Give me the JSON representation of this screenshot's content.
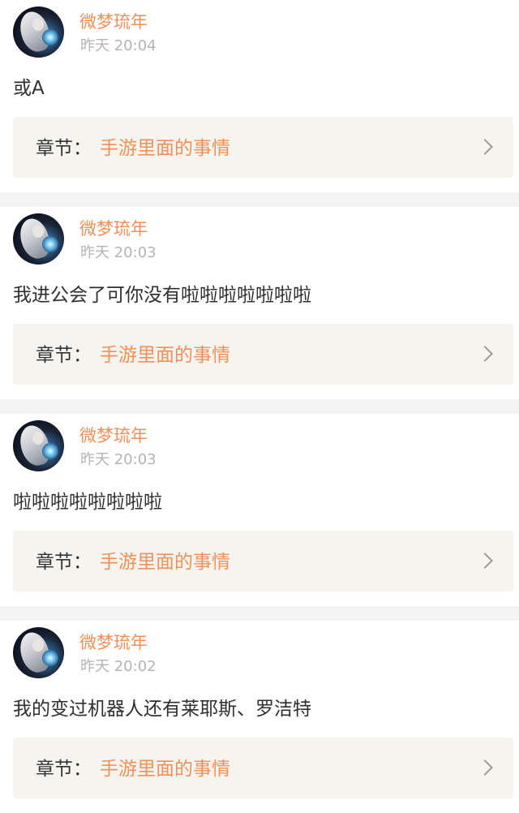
{
  "posts": [
    {
      "username": "微梦琉年",
      "time": "昨天 20:04",
      "content": "或A",
      "chapter_label": "章节：",
      "chapter_title": "手游里面的事情"
    },
    {
      "username": "微梦琉年",
      "time": "昨天 20:03",
      "content": "我进公会了可你没有啦啦啦啦啦啦啦",
      "chapter_label": "章节：",
      "chapter_title": "手游里面的事情"
    },
    {
      "username": "微梦琉年",
      "time": "昨天 20:03",
      "content": "啦啦啦啦啦啦啦啦",
      "chapter_label": "章节：",
      "chapter_title": "手游里面的事情"
    },
    {
      "username": "微梦琉年",
      "time": "昨天 20:02",
      "content": "我的变过机器人还有莱耶斯、罗洁特",
      "chapter_label": "章节：",
      "chapter_title": "手游里面的事情"
    }
  ],
  "icons": {
    "avatar": "user-avatar-icon",
    "chevron": "chevron-right-icon"
  },
  "colors": {
    "username": "#f0905a",
    "chapter_title": "#f0905a",
    "timestamp": "#b4b4b4",
    "chapter_background": "#f5f4ef",
    "separator": "#f3f3f3"
  }
}
